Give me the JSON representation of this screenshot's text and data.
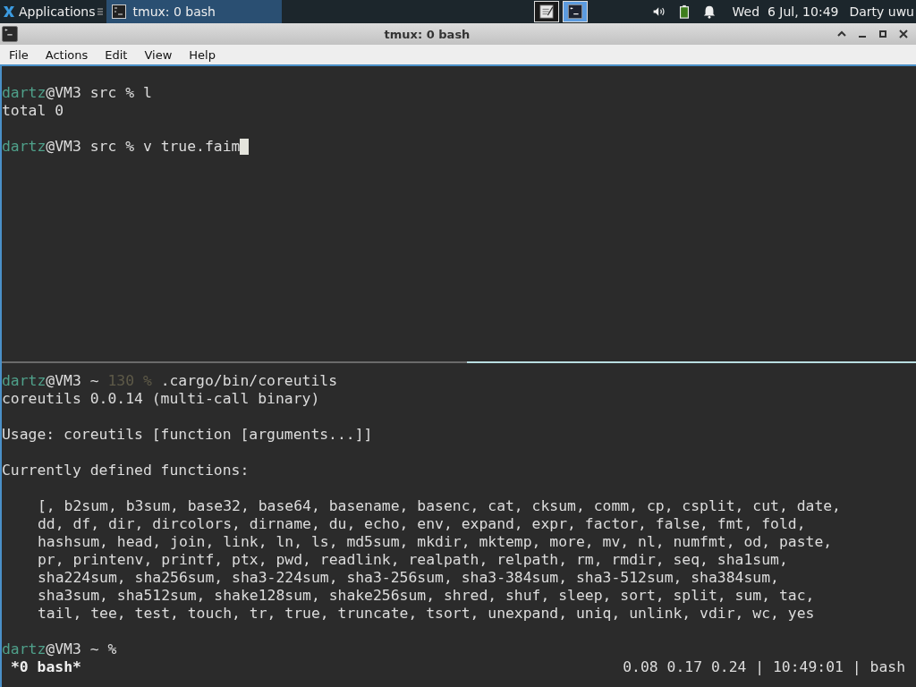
{
  "top_panel": {
    "menu_label": "Applications",
    "tasks": [
      {
        "title": "tmux: 0 bash",
        "selected": true
      }
    ],
    "launchers": [
      {
        "kind": "editor",
        "selected": false
      },
      {
        "kind": "terminal",
        "selected": true
      }
    ],
    "clock": "Wed  6 Jul, 10:49",
    "user": "Darty uwu"
  },
  "window": {
    "title": "tmux: 0 bash"
  },
  "menu": [
    "File",
    "Actions",
    "Edit",
    "View",
    "Help"
  ],
  "panes": [
    {
      "active": true,
      "lines": [
        {
          "kind": "blank"
        },
        {
          "kind": "text",
          "segments": [
            {
              "kind": "user",
              "text": "dartz"
            },
            {
              "kind": "plain",
              "text": "@VM3 src % l"
            }
          ]
        },
        {
          "kind": "text",
          "segments": [
            {
              "kind": "plain",
              "text": "total 0"
            }
          ]
        },
        {
          "kind": "blank"
        },
        {
          "kind": "text",
          "cursor": true,
          "segments": [
            {
              "kind": "user",
              "text": "dartz"
            },
            {
              "kind": "plain",
              "text": "@VM3 src % v true.faim"
            }
          ]
        }
      ]
    },
    {
      "active": false,
      "lines": [
        {
          "kind": "text",
          "segments": [
            {
              "kind": "user",
              "text": "dartz"
            },
            {
              "kind": "plain",
              "text": "@VM3 ~ "
            },
            {
              "kind": "dim",
              "text": "130 %"
            },
            {
              "kind": "plain",
              "text": " .cargo/bin/coreutils"
            }
          ]
        },
        {
          "kind": "text",
          "segments": [
            {
              "kind": "plain",
              "text": "coreutils 0.0.14 (multi-call binary)"
            }
          ]
        },
        {
          "kind": "blank"
        },
        {
          "kind": "text",
          "segments": [
            {
              "kind": "plain",
              "text": "Usage: coreutils [function [arguments...]]"
            }
          ]
        },
        {
          "kind": "blank"
        },
        {
          "kind": "text",
          "segments": [
            {
              "kind": "plain",
              "text": "Currently defined functions:"
            }
          ]
        },
        {
          "kind": "blank"
        },
        {
          "kind": "list",
          "segments": [
            {
              "kind": "plain",
              "text": "[, b2sum, b3sum, base32, base64, basename, basenc, cat, cksum, comm, cp, csplit, cut, date,"
            }
          ]
        },
        {
          "kind": "list",
          "segments": [
            {
              "kind": "plain",
              "text": "dd, df, dir, dircolors, dirname, du, echo, env, expand, expr, factor, false, fmt, fold,"
            }
          ]
        },
        {
          "kind": "list",
          "segments": [
            {
              "kind": "plain",
              "text": "hashsum, head, join, link, ln, ls, md5sum, mkdir, mktemp, more, mv, nl, numfmt, od, paste,"
            }
          ]
        },
        {
          "kind": "list",
          "segments": [
            {
              "kind": "plain",
              "text": "pr, printenv, printf, ptx, pwd, readlink, realpath, relpath, rm, rmdir, seq, sha1sum,"
            }
          ]
        },
        {
          "kind": "list",
          "segments": [
            {
              "kind": "plain",
              "text": "sha224sum, sha256sum, sha3-224sum, sha3-256sum, sha3-384sum, sha3-512sum, sha384sum,"
            }
          ]
        },
        {
          "kind": "list",
          "segments": [
            {
              "kind": "plain",
              "text": "sha3sum, sha512sum, shake128sum, shake256sum, shred, shuf, sleep, sort, split, sum, tac,"
            }
          ]
        },
        {
          "kind": "list",
          "segments": [
            {
              "kind": "plain",
              "text": "tail, tee, test, touch, tr, true, truncate, tsort, unexpand, uniq, unlink, vdir, wc, yes"
            }
          ]
        },
        {
          "kind": "blank"
        },
        {
          "kind": "text",
          "segments": [
            {
              "kind": "user",
              "text": "dartz"
            },
            {
              "kind": "plain",
              "text": "@VM3 ~ %"
            }
          ]
        }
      ]
    }
  ],
  "status_bar": {
    "window_label": "*0 bash*",
    "info": "0.08 0.17 0.24 | 10:49:01 | bash"
  }
}
